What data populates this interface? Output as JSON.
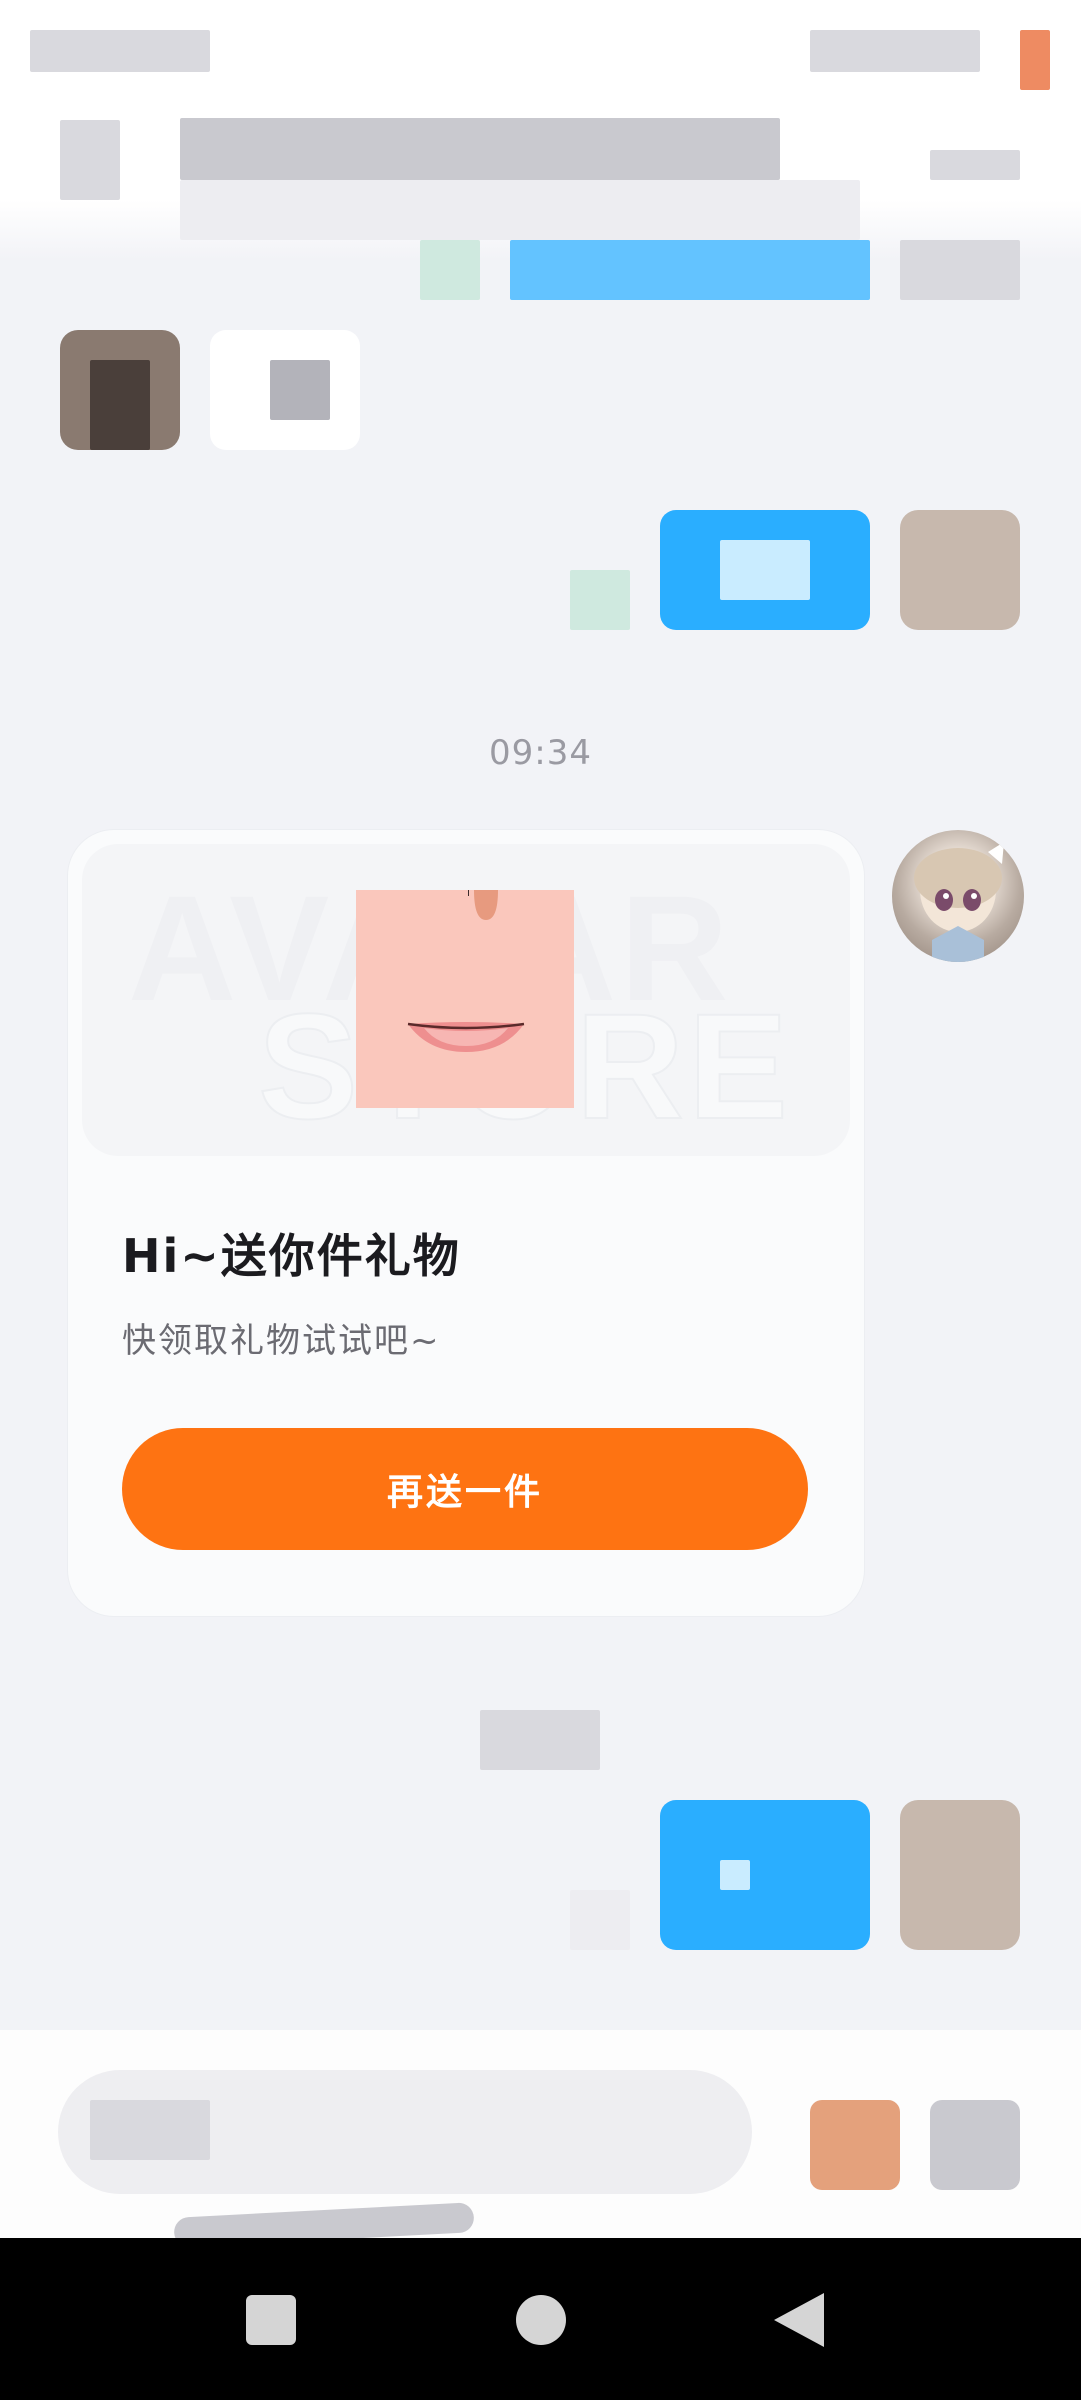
{
  "chat": {
    "timestamp": "09:34"
  },
  "gift_card": {
    "watermark_line1": "AVATAR",
    "watermark_line2": "STORE",
    "title": "Hi~送你件礼物",
    "subtitle": "快领取礼物试试吧~",
    "cta_label": "再送一件"
  },
  "colors": {
    "accent_orange": "#fe7312",
    "bubble_blue": "#2aaeff",
    "background": "#f2f3f7"
  },
  "icons": {
    "nav_recent": "square-icon",
    "nav_home": "circle-icon",
    "nav_back": "triangle-back-icon"
  }
}
